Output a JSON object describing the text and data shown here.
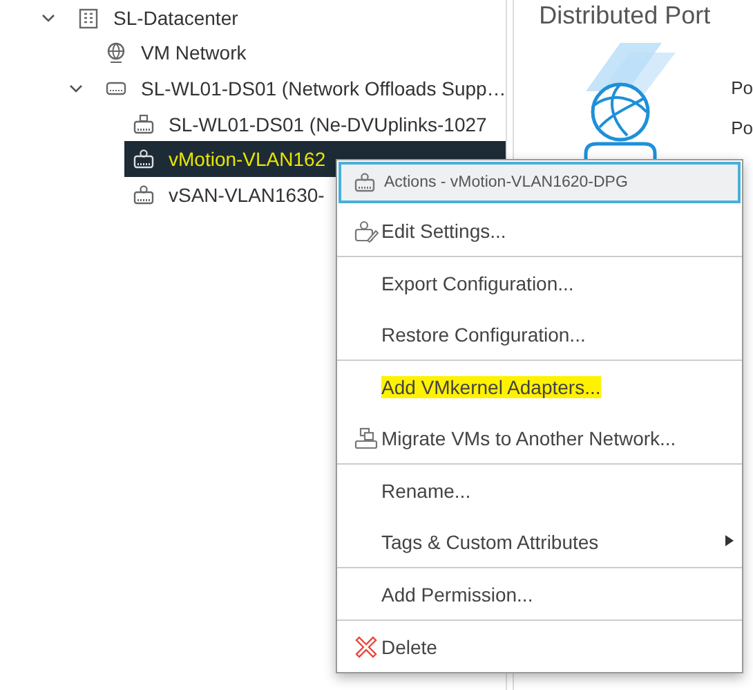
{
  "tree": [
    {
      "label": "SL-Datacenter",
      "kind": "datacenter",
      "expanded": true,
      "selected": false,
      "highlighted": false,
      "children": [
        {
          "label": "VM Network",
          "kind": "network",
          "selected": false,
          "highlighted": false
        },
        {
          "label": "SL-WL01-DS01 (Network Offloads Supp…",
          "kind": "switch",
          "expanded": true,
          "selected": false,
          "highlighted": false,
          "children": [
            {
              "label": "SL-WL01-DS01 (Ne-DVUplinks-1027",
              "kind": "uplink",
              "selected": false,
              "highlighted": false
            },
            {
              "label": "vMotion-VLAN162",
              "kind": "portgroup",
              "selected": true,
              "highlighted": true
            },
            {
              "label": "vSAN-VLAN1630-",
              "kind": "portgroup",
              "selected": false,
              "highlighted": false
            }
          ]
        }
      ]
    }
  ],
  "detail": {
    "title": "Distributed Port",
    "labels": [
      "Po",
      "Po"
    ]
  },
  "context_menu": {
    "header": "Actions - vMotion-VLAN1620-DPG",
    "items": [
      {
        "label": "Edit Settings...",
        "kind": "edit",
        "divider_after": true,
        "highlighted": false
      },
      {
        "label": "Export Configuration...",
        "kind": "plain",
        "divider_after": false,
        "highlighted": false
      },
      {
        "label": "Restore Configuration...",
        "kind": "plain",
        "divider_after": true,
        "highlighted": false
      },
      {
        "label": "Add VMkernel Adapters...",
        "kind": "plain",
        "divider_after": false,
        "highlighted": true
      },
      {
        "label": "Migrate VMs to Another Network...",
        "kind": "migrate",
        "divider_after": true,
        "highlighted": false
      },
      {
        "label": "Rename...",
        "kind": "plain",
        "divider_after": false,
        "highlighted": false
      },
      {
        "label": "Tags & Custom Attributes",
        "kind": "submenu",
        "divider_after": true,
        "highlighted": false
      },
      {
        "label": "Add Permission...",
        "kind": "plain",
        "divider_after": true,
        "highlighted": false
      },
      {
        "label": "Delete",
        "kind": "delete",
        "divider_after": false,
        "highlighted": false
      }
    ]
  }
}
